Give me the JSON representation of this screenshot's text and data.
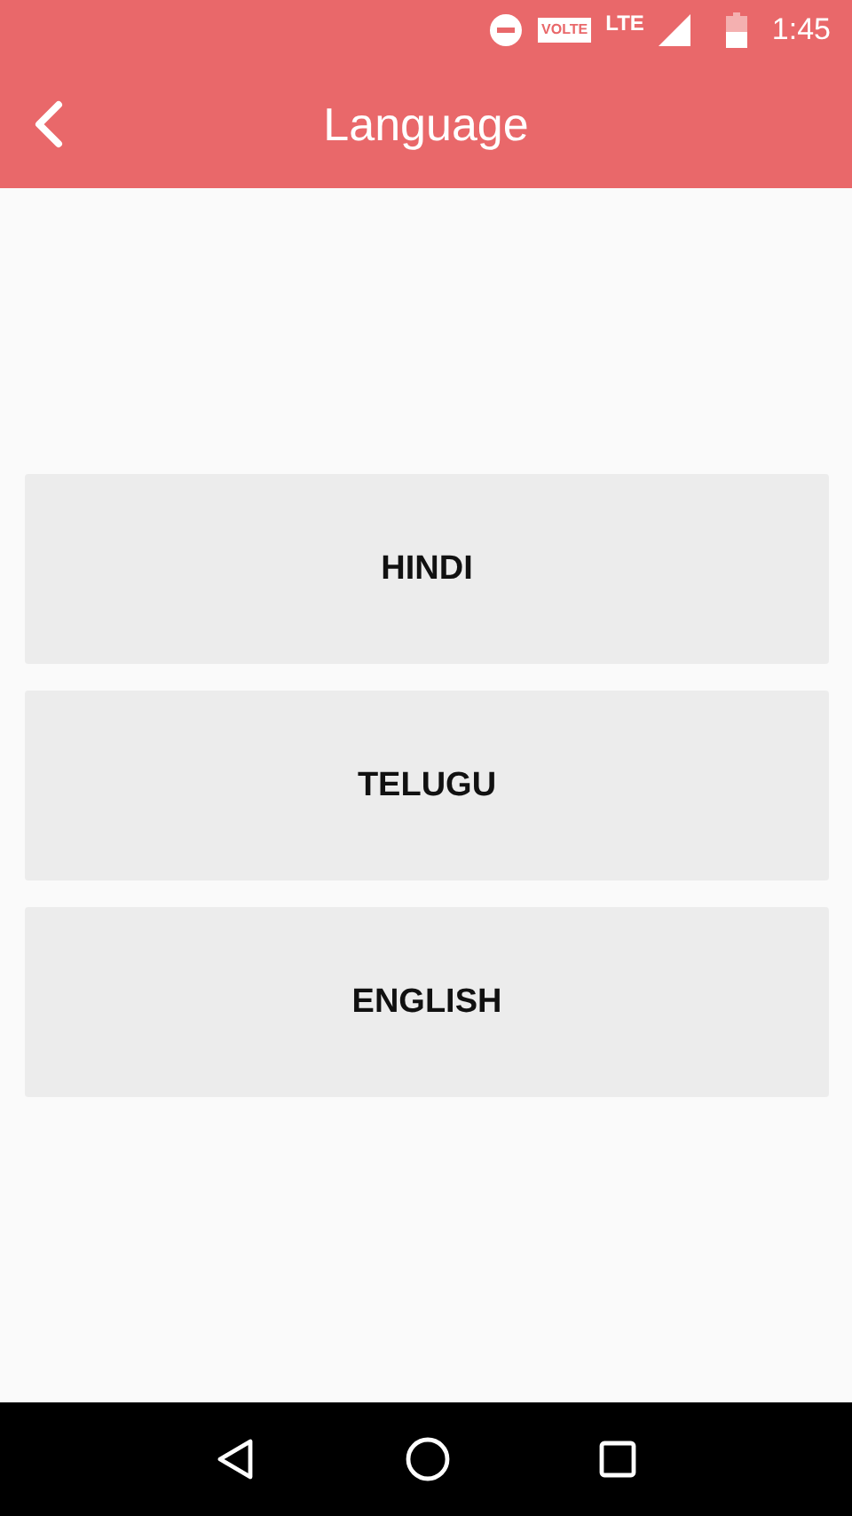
{
  "status_bar": {
    "volte_badge": "VOLTE",
    "network": "LTE",
    "time": "1:45"
  },
  "app_bar": {
    "title": "Language"
  },
  "languages": [
    {
      "label": "HINDI"
    },
    {
      "label": "TELUGU"
    },
    {
      "label": "ENGLISH"
    }
  ]
}
